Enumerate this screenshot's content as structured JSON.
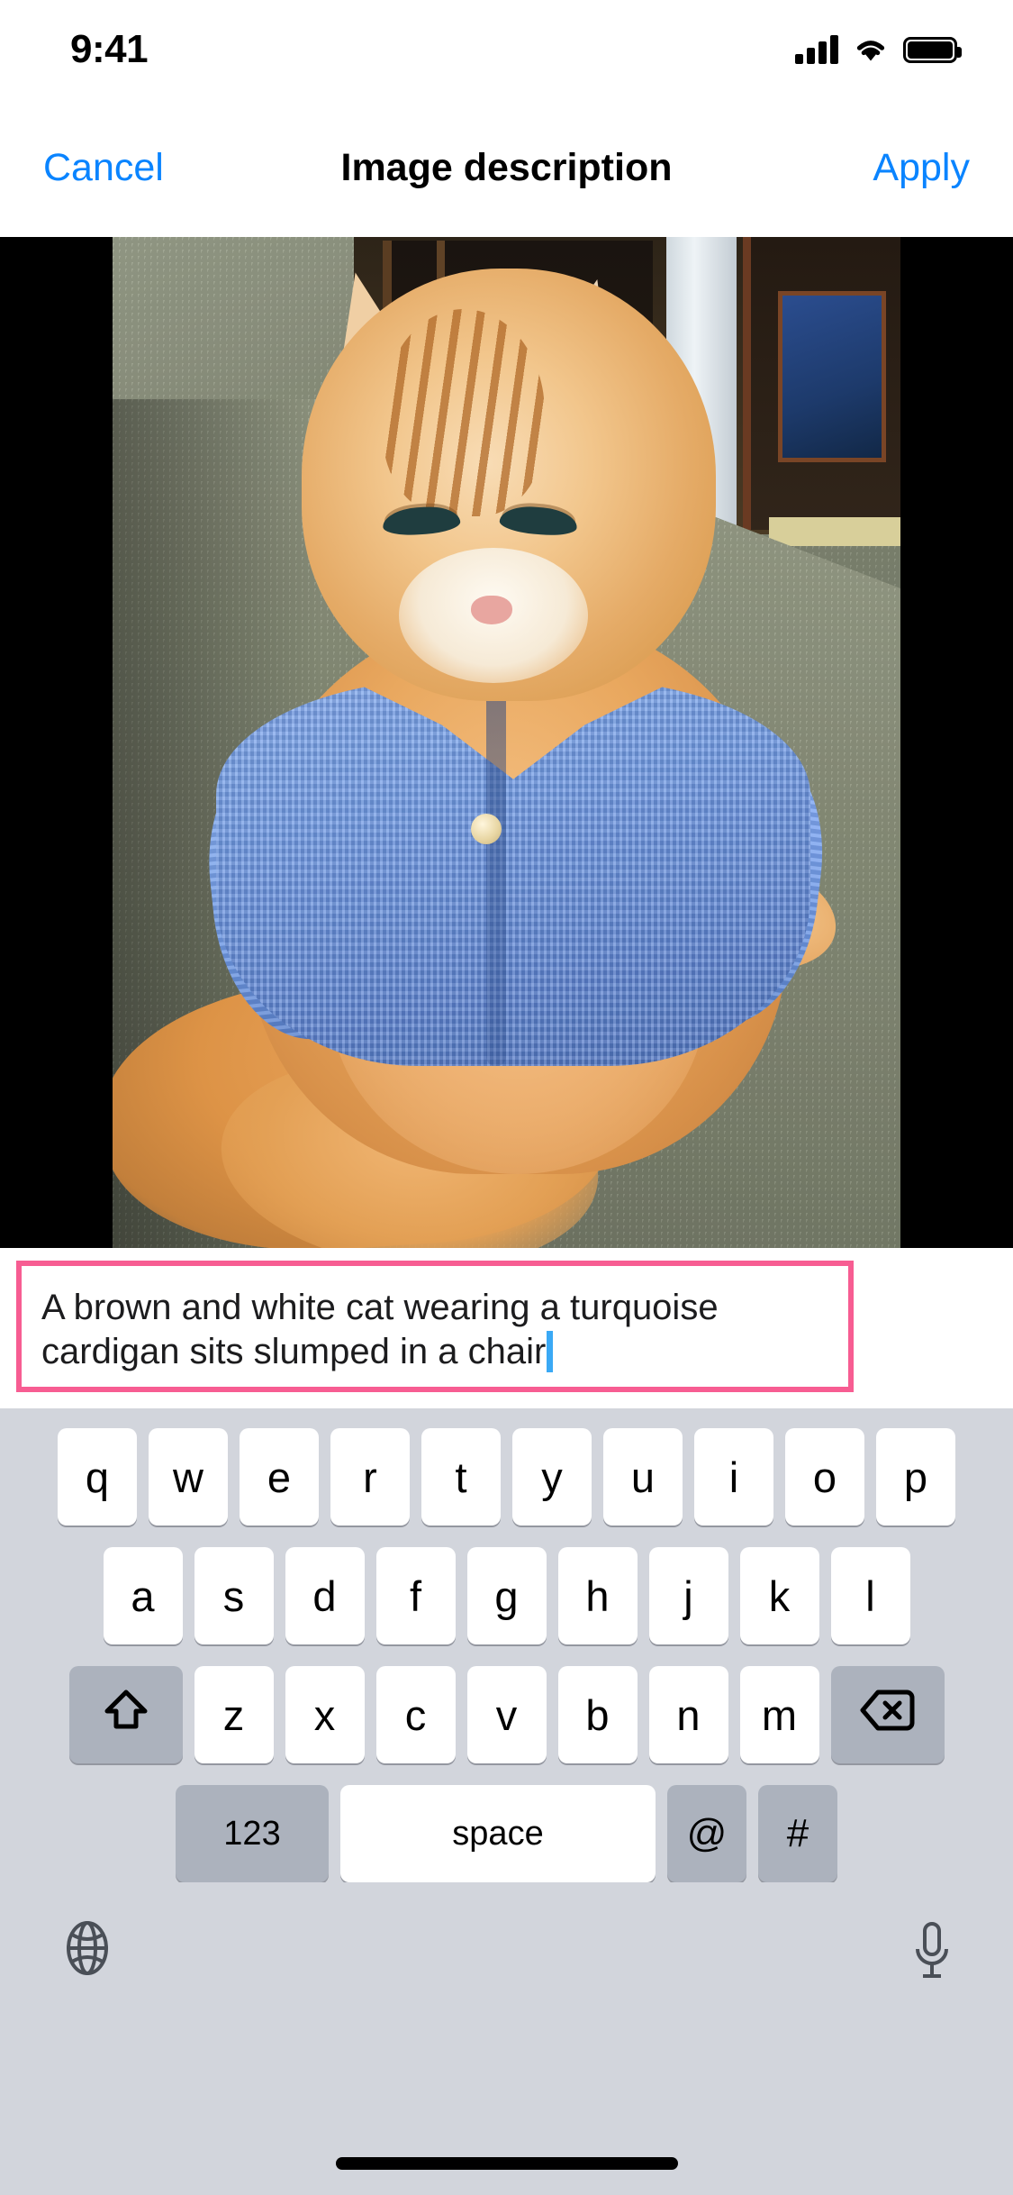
{
  "status_bar": {
    "time": "9:41",
    "cellular_icon": "cellular-bars-icon",
    "wifi_icon": "wifi-icon",
    "battery_icon": "battery-full-icon"
  },
  "nav_bar": {
    "cancel_label": "Cancel",
    "title": "Image description",
    "apply_label": "Apply",
    "tint_color": "#0a84ff"
  },
  "image_viewer": {
    "letterbox_color": "#000000",
    "photo_alt": "Orange and white long-haired cat wearing a blue knitted cardigan, slumped in a green upholstered chair"
  },
  "description_field": {
    "value": "A brown and white cat wearing a turquoise cardigan sits slumped in a chair",
    "line_1": "A brown and white cat wearing a turquoise",
    "line_2": "cardigan sits slumped in a chair",
    "border_color": "#f75d92",
    "caret_color": "#3aa9f5",
    "focused": true
  },
  "keyboard": {
    "background_color": "#d2d5dc",
    "row_1": [
      "q",
      "w",
      "e",
      "r",
      "t",
      "y",
      "u",
      "i",
      "o",
      "p"
    ],
    "row_2": [
      "a",
      "s",
      "d",
      "f",
      "g",
      "h",
      "j",
      "k",
      "l"
    ],
    "row_3_letters": [
      "z",
      "x",
      "c",
      "v",
      "b",
      "n",
      "m"
    ],
    "shift_key": "shift-icon",
    "backspace_key": "backspace-icon",
    "numbers_key": "123",
    "space_key": "space",
    "at_key": "@",
    "hash_key": "#",
    "globe_key": "globe-icon",
    "dictation_key": "microphone-icon"
  },
  "home_indicator": "home-indicator"
}
